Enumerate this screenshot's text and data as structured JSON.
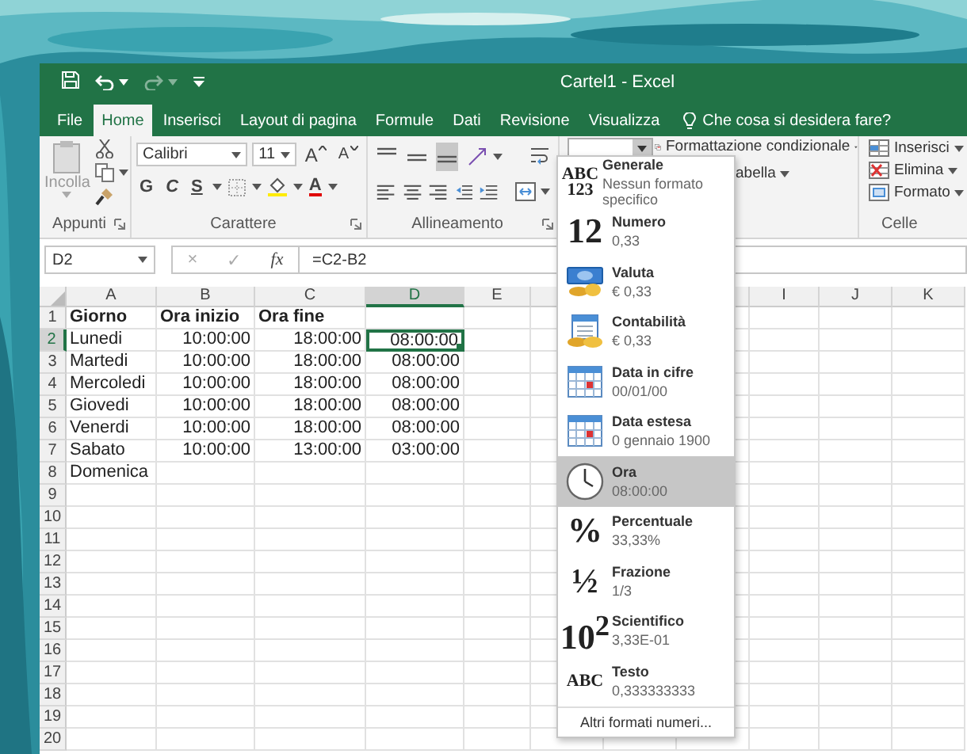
{
  "window": {
    "title": "Cartel1 - Excel"
  },
  "quick_access": [
    {
      "kind": "save",
      "disabled": false
    },
    {
      "kind": "undo",
      "disabled": false
    },
    {
      "kind": "redo",
      "disabled": true
    },
    {
      "kind": "customize",
      "disabled": false
    }
  ],
  "tabs": [
    {
      "label": "File",
      "selected": false
    },
    {
      "label": "Home",
      "selected": true
    },
    {
      "label": "Inserisci",
      "selected": false
    },
    {
      "label": "Layout di pagina",
      "selected": false
    },
    {
      "label": "Formule",
      "selected": false
    },
    {
      "label": "Dati",
      "selected": false
    },
    {
      "label": "Revisione",
      "selected": false
    },
    {
      "label": "Visualizza",
      "selected": false
    }
  ],
  "tell_me": {
    "placeholder": "Che cosa si desidera fare?"
  },
  "ribbon": {
    "clipboard": {
      "paste_label": "Incolla",
      "paste_disabled": true,
      "group_label": "Appunti"
    },
    "font": {
      "name": "Calibri",
      "size": "11",
      "grow": "A",
      "shrink": "A",
      "bold": "G",
      "italic": "C",
      "underline": "S",
      "font_color": "A",
      "group_label": "Carattere"
    },
    "alignment": {
      "group_label": "Allineamento"
    },
    "styles": {
      "conditional": "Formattazione condizionale",
      "table": "abella"
    },
    "cells": {
      "buttons": [
        {
          "kind": "insert",
          "label": "Inserisci"
        },
        {
          "kind": "delete",
          "label": "Elimina"
        },
        {
          "kind": "format",
          "label": "Formato"
        }
      ],
      "group_label": "Celle"
    }
  },
  "formula_bar": {
    "name_box": "D2",
    "cancel": "×",
    "enter": "✓",
    "function": "fx",
    "formula": "=C2-B2"
  },
  "sheet": {
    "columns": [
      {
        "label": "A",
        "selected": false
      },
      {
        "label": "B",
        "selected": false
      },
      {
        "label": "C",
        "selected": false
      },
      {
        "label": "D",
        "selected": true
      },
      {
        "label": "E",
        "selected": false
      },
      {
        "label": "I",
        "selected": false
      },
      {
        "label": "J",
        "selected": false
      },
      {
        "label": "K",
        "selected": false
      }
    ],
    "rows": [
      {
        "number": "1",
        "selected": false,
        "kind": "header",
        "cells": [
          "Giorno",
          "Ora inizio",
          "Ora fine"
        ]
      },
      {
        "number": "2",
        "selected": true,
        "kind": "data",
        "cells": [
          "Lunedi",
          "10:00:00",
          "18:00:00",
          "08:00:00"
        ]
      },
      {
        "number": "3",
        "selected": false,
        "kind": "data",
        "cells": [
          "Martedi",
          "10:00:00",
          "18:00:00",
          "08:00:00"
        ]
      },
      {
        "number": "4",
        "selected": false,
        "kind": "data",
        "cells": [
          "Mercoledi",
          "10:00:00",
          "18:00:00",
          "08:00:00"
        ]
      },
      {
        "number": "5",
        "selected": false,
        "kind": "data",
        "cells": [
          "Giovedi",
          "10:00:00",
          "18:00:00",
          "08:00:00"
        ]
      },
      {
        "number": "6",
        "selected": false,
        "kind": "data",
        "cells": [
          "Venerdi",
          "10:00:00",
          "18:00:00",
          "08:00:00"
        ]
      },
      {
        "number": "7",
        "selected": false,
        "kind": "data",
        "cells": [
          "Sabato",
          "10:00:00",
          "13:00:00",
          "03:00:00"
        ]
      },
      {
        "number": "8",
        "selected": false,
        "kind": "data",
        "cells": [
          "Domenica"
        ]
      },
      {
        "number": "9",
        "selected": false,
        "kind": "data"
      },
      {
        "number": "10",
        "selected": false,
        "kind": "data"
      },
      {
        "number": "11",
        "selected": false,
        "kind": "data"
      },
      {
        "number": "12",
        "selected": false,
        "kind": "data"
      },
      {
        "number": "13",
        "selected": false,
        "kind": "data"
      },
      {
        "number": "14",
        "selected": false,
        "kind": "data"
      },
      {
        "number": "15",
        "selected": false,
        "kind": "data"
      },
      {
        "number": "16",
        "selected": false,
        "kind": "data"
      },
      {
        "number": "17",
        "selected": false,
        "kind": "data"
      },
      {
        "number": "18",
        "selected": false,
        "kind": "data"
      },
      {
        "number": "19",
        "selected": false,
        "kind": "data"
      },
      {
        "number": "20",
        "selected": false,
        "kind": "data"
      }
    ]
  },
  "number_format_menu": {
    "items": [
      {
        "kind": "stacked-glyph",
        "glyph": [
          "ABC",
          "123"
        ],
        "label": "Generale",
        "sample": "Nessun formato specifico",
        "selected": false
      },
      {
        "kind": "glyph",
        "glyph": [
          "12"
        ],
        "label": "Numero",
        "sample": "0,33",
        "selected": false
      },
      {
        "kind": "currency",
        "label": "Valuta",
        "sample": "€ 0,33",
        "selected": false
      },
      {
        "kind": "accounting",
        "label": "Contabilità",
        "sample": "€ 0,33",
        "selected": false
      },
      {
        "kind": "date",
        "label": "Data in cifre",
        "sample": "00/01/00",
        "selected": false
      },
      {
        "kind": "date",
        "label": "Data estesa",
        "sample": "0 gennaio 1900",
        "selected": false
      },
      {
        "kind": "time",
        "label": "Ora",
        "sample": "08:00:00",
        "selected": true
      },
      {
        "kind": "glyph",
        "glyph": [
          "%"
        ],
        "label": "Percentuale",
        "sample": "33,33%",
        "selected": false
      },
      {
        "kind": "glyph",
        "glyph": [
          "½"
        ],
        "label": "Frazione",
        "sample": "1/3",
        "selected": false
      },
      {
        "kind": "glyph",
        "glyph": [
          "10$^{2}$"
        ],
        "label": "Scientifico",
        "sample": "3,33E-01",
        "selected": false
      },
      {
        "kind": "small-glyph",
        "glyph": [
          "ABC"
        ],
        "label": "Testo",
        "sample": "0,333333333",
        "selected": false
      }
    ],
    "footer": "Altri formati numeri..."
  }
}
